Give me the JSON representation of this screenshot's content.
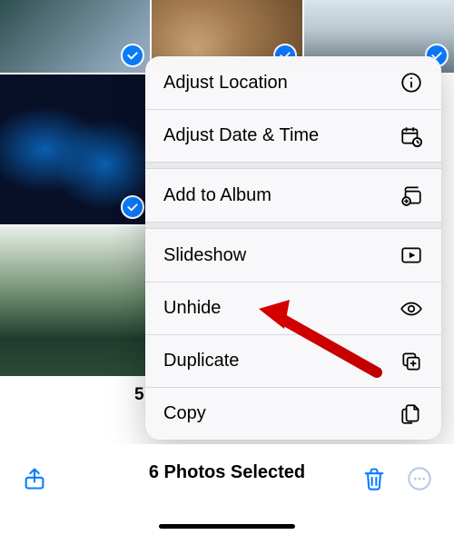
{
  "menu": {
    "items": [
      {
        "label": "Adjust Location",
        "icon": "info-circle-icon"
      },
      {
        "label": "Adjust Date & Time",
        "icon": "calendar-clock-icon"
      },
      {
        "label": "Add to Album",
        "icon": "album-add-icon"
      },
      {
        "label": "Slideshow",
        "icon": "play-rect-icon"
      },
      {
        "label": "Unhide",
        "icon": "eye-icon"
      },
      {
        "label": "Duplicate",
        "icon": "duplicate-icon"
      },
      {
        "label": "Copy",
        "icon": "copy-doc-icon"
      }
    ]
  },
  "grid": {
    "count_label": "5"
  },
  "toolbar": {
    "title": "6 Photos Selected"
  },
  "colors": {
    "accent_blue": "#0a7cff",
    "annotation_red": "#d40000"
  }
}
